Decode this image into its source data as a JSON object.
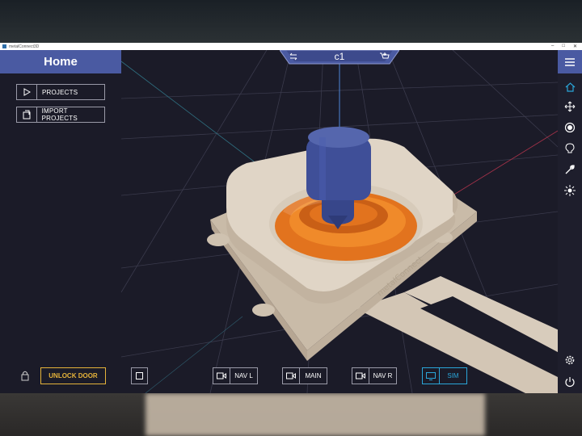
{
  "window": {
    "title": "metalConnect3D"
  },
  "sidebar": {
    "title": "Home",
    "items": [
      {
        "label": "PROJECTS",
        "icon": "play-icon"
      },
      {
        "label": "IMPORT PROJECTS",
        "icon": "import-icon"
      }
    ]
  },
  "topnav": {
    "name": "c1",
    "left_icon": "swap-icon",
    "right_icon": "add-cart-icon"
  },
  "rail": {
    "icons": [
      "home-icon",
      "move-icon",
      "target-icon",
      "bulb-icon",
      "wrench-icon",
      "light-icon",
      "settings-icon",
      "power-icon"
    ],
    "accent": "#2aa6d9"
  },
  "toolbar": {
    "unlock_label": "UNLOCK DOOR",
    "views": [
      {
        "label": "NAV L",
        "active": false
      },
      {
        "label": "MAIN",
        "active": false
      },
      {
        "label": "NAV R",
        "active": false
      },
      {
        "label": "SIM",
        "active": true
      }
    ]
  },
  "colors": {
    "header": "#4a5aa2",
    "background": "#1b1b28",
    "warning": "#e6b33a",
    "active": "#2aa6d9",
    "part_beige": "#d6cab9",
    "part_orange": "#e2731e",
    "tool_blue": "#3f4f98"
  }
}
